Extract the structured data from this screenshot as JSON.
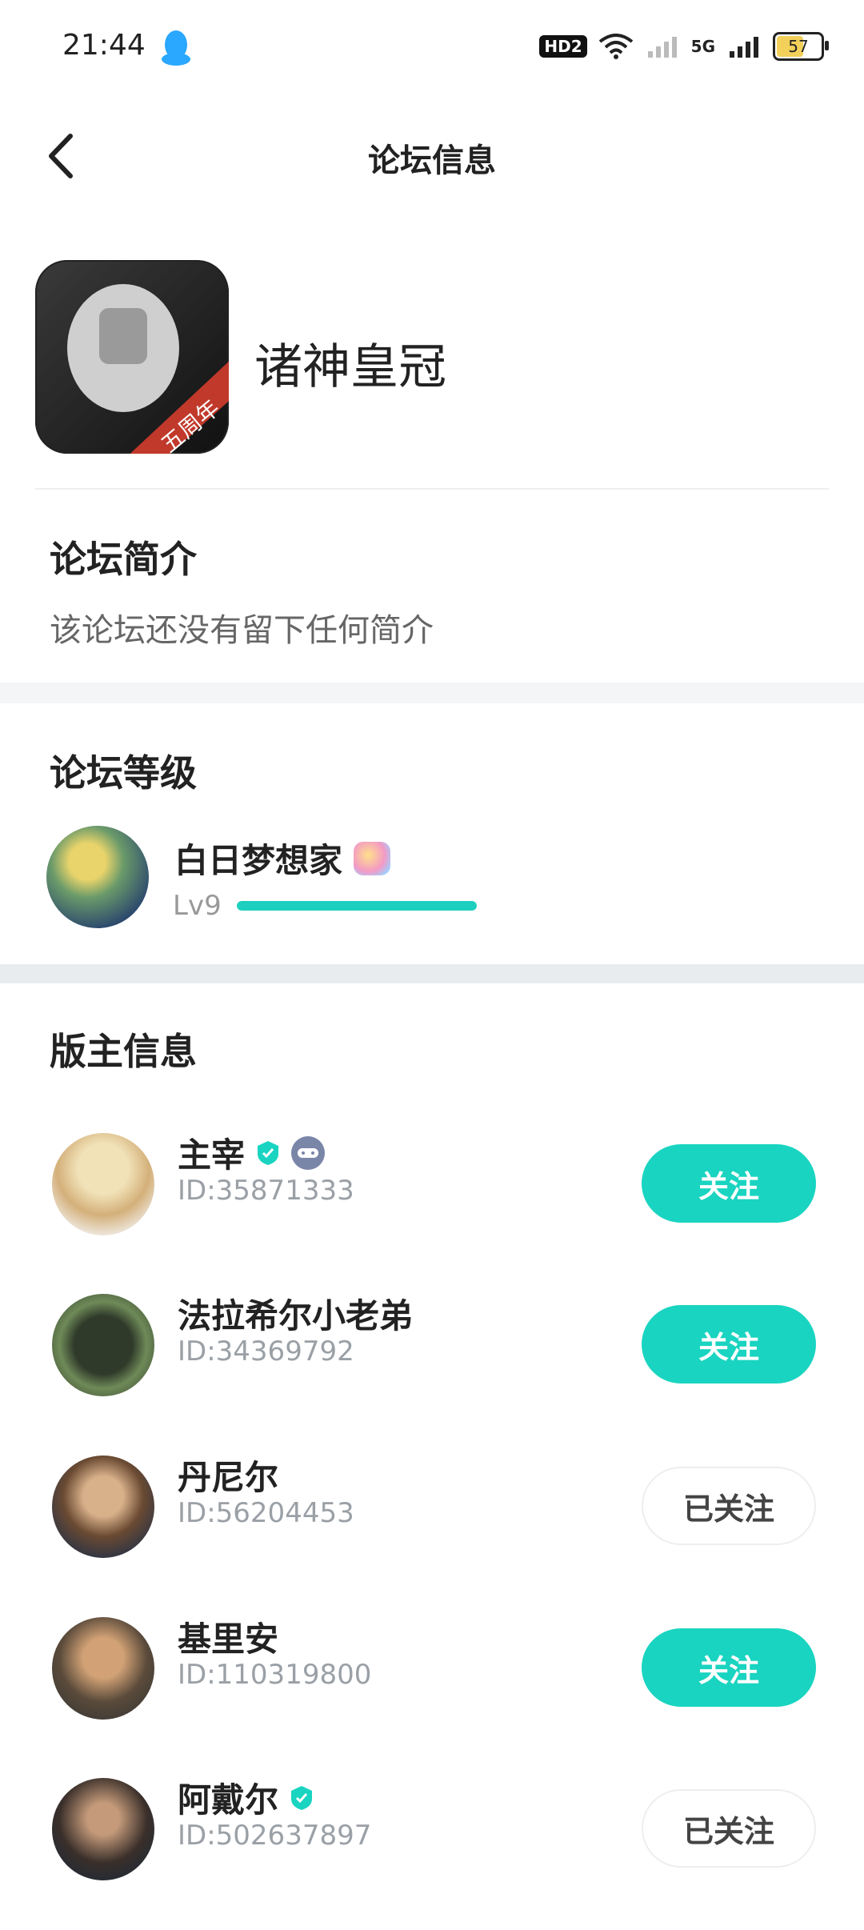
{
  "status_bar": {
    "time": "21:44",
    "hd_label": "HD2",
    "network_label": "5G",
    "battery": "57",
    "battery_level": 0.57
  },
  "header": {
    "title": "论坛信息"
  },
  "forum": {
    "name": "诸神皇冠",
    "avatar_banner": "五周年"
  },
  "intro": {
    "title": "论坛简介",
    "text": "该论坛还没有留下任何简介"
  },
  "level": {
    "title": "论坛等级",
    "name": "白日梦想家",
    "lv": "Lv9",
    "progress": 1.0
  },
  "moderators": {
    "title": "版主信息",
    "items": [
      {
        "name": "主宰",
        "id": "ID:35871333",
        "button": "关注",
        "followed": false,
        "verified": true,
        "gamepad": true
      },
      {
        "name": "法拉希尔小老弟",
        "id": "ID:34369792",
        "button": "关注",
        "followed": false,
        "verified": false,
        "gamepad": false
      },
      {
        "name": "丹尼尔",
        "id": "ID:56204453",
        "button": "已关注",
        "followed": true,
        "verified": false,
        "gamepad": false
      },
      {
        "name": "基里安",
        "id": "ID:110319800",
        "button": "关注",
        "followed": false,
        "verified": false,
        "gamepad": false
      },
      {
        "name": "阿戴尔",
        "id": "ID:502637897",
        "button": "已关注",
        "followed": true,
        "verified": true,
        "gamepad": false
      }
    ]
  },
  "colors": {
    "accent": "#19d4c0",
    "muted_text": "#9aa0a6"
  }
}
